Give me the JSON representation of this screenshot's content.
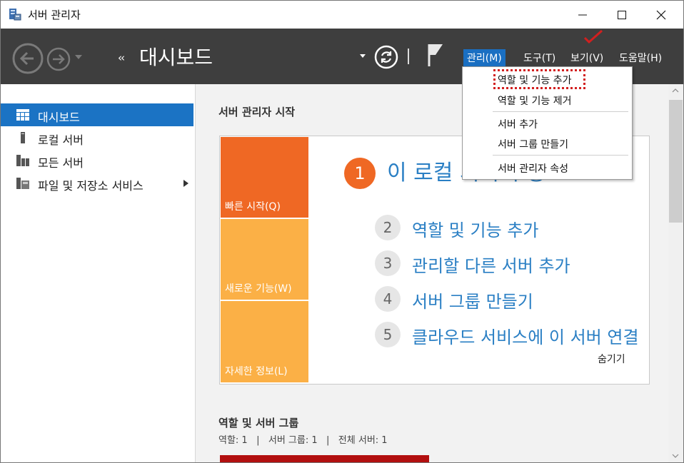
{
  "window": {
    "title": "서버 관리자",
    "controls": [
      "minimize",
      "maximize",
      "close"
    ]
  },
  "header": {
    "breadcrumb_arrows": "‹‹",
    "page_title": "대시보드",
    "menu": {
      "manage": "관리(M)",
      "tools": "도구(T)",
      "view": "보기(V)",
      "help": "도움말(H)"
    }
  },
  "sidebar": {
    "items": [
      {
        "label": "대시보드",
        "icon": "dashboard-icon",
        "active": true
      },
      {
        "label": "로컬 서버",
        "icon": "local-server-icon",
        "active": false
      },
      {
        "label": "모든 서버",
        "icon": "all-servers-icon",
        "active": false
      },
      {
        "label": "파일 및 저장소 서비스",
        "icon": "file-storage-icon",
        "active": false
      }
    ]
  },
  "main": {
    "start_title": "서버 관리자 시작",
    "tiles": {
      "quick": "빠른 시작(Q)",
      "new": "새로운 기능(W)",
      "more": "자세한 정보(L)"
    },
    "steps": [
      {
        "num": "1",
        "label": "이 로컬 서버 구성"
      },
      {
        "num": "2",
        "label": "역할 및 기능 추가"
      },
      {
        "num": "3",
        "label": "관리할 다른 서버 추가"
      },
      {
        "num": "4",
        "label": "서버 그룹 만들기"
      },
      {
        "num": "5",
        "label": "클라우드 서비스에 이 서버 연결"
      }
    ],
    "hide_link": "숨기기",
    "roles_title": "역할 및 서버 그룹",
    "roles_stats": "역할: 1   |   서버 그룹: 1   |   전체 서버: 1"
  },
  "dropdown": {
    "items": [
      "역할 및 기능 추가",
      "역할 및 기능 제거",
      "서버 추가",
      "서버 그룹 만들기",
      "서버 관리자 속성"
    ]
  },
  "colors": {
    "accent_blue": "#1b73c4",
    "tile_orange": "#ef6824",
    "tile_yellow": "#fbb046",
    "link_blue": "#2a7fc4",
    "highlight_red": "#d21f1f"
  }
}
